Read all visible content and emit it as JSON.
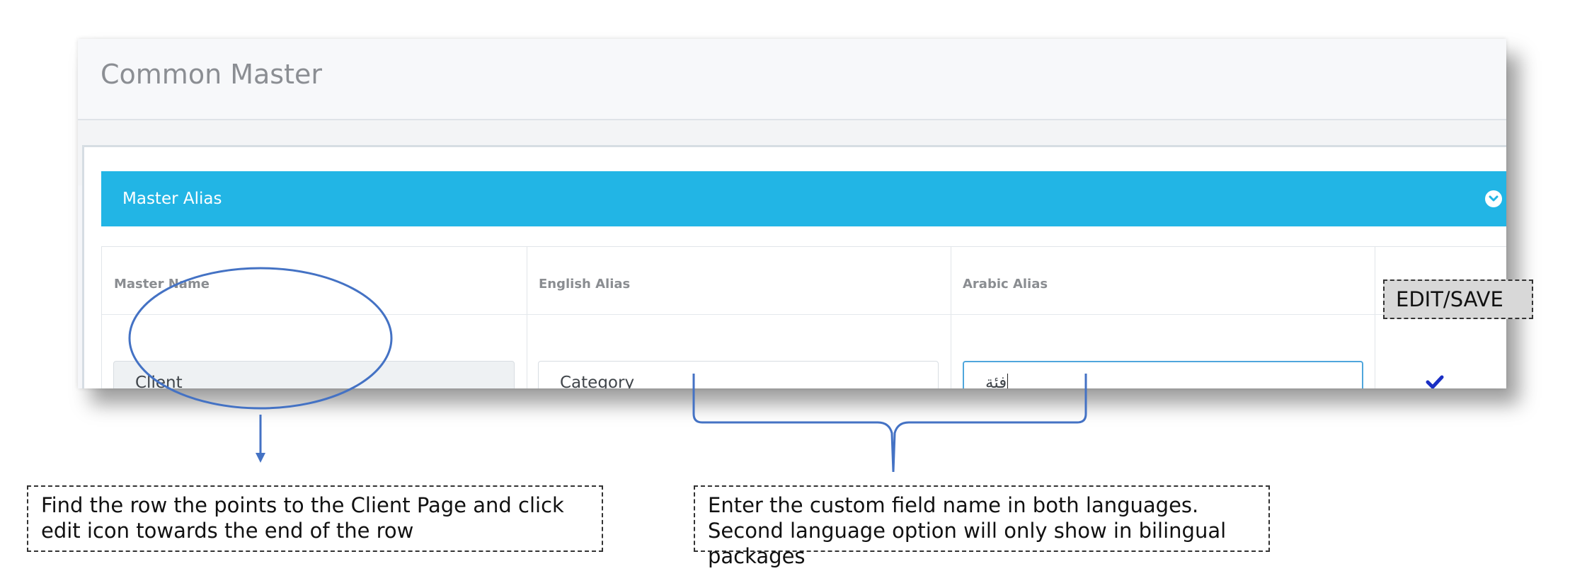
{
  "page": {
    "title": "Common Master"
  },
  "panel": {
    "title": "Master Alias"
  },
  "table": {
    "headers": [
      "Master Name",
      "English Alias",
      "Arabic Alias"
    ],
    "row": {
      "master_name": "Client",
      "english_alias": "Category",
      "arabic_alias": "فئة"
    }
  },
  "annotations": {
    "edit_save": "EDIT/SAVE",
    "left_note": "Find the row the points to the Client Page and click edit icon towards the end of the row",
    "right_note": "Enter the custom field name in both languages. Second language option will only show in bilingual packages"
  },
  "icons": {
    "collapse": "chevron-down-circle-icon",
    "save": "check-icon"
  },
  "colors": {
    "panel_header": "#22b5e5",
    "annotation_stroke": "#4472c4",
    "check": "#1a2fc4"
  }
}
